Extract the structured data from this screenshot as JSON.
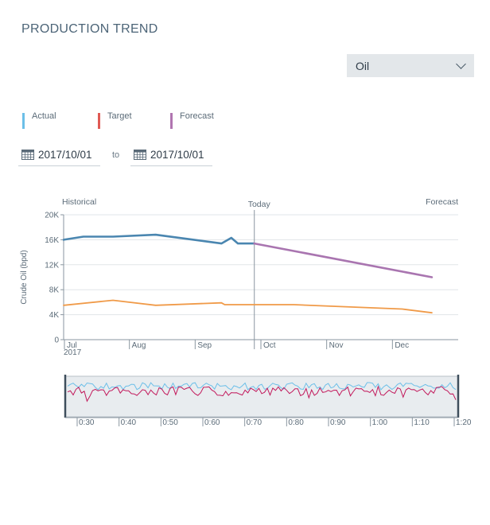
{
  "title": "PRODUCTION TREND",
  "product_select": {
    "value": "Oil"
  },
  "legend": [
    {
      "label": "Actual",
      "color": "#6cbfe8"
    },
    {
      "label": "Target",
      "color": "#e05a54"
    },
    {
      "label": "Forecast",
      "color": "#b075b0"
    }
  ],
  "date_range": {
    "from": "2017/10/01",
    "to_label": "to",
    "to": "2017/10/01"
  },
  "icons": {
    "date_picker": "calendar-icon",
    "select": "chevron-down-icon"
  },
  "chart_data": {
    "type": "line",
    "ylabel": "Crude Oil (bpd)",
    "yticks": [
      "0",
      "4K",
      "8K",
      "12K",
      "16K",
      "20K"
    ],
    "ylim": [
      0,
      20000
    ],
    "xlim": [
      0,
      6
    ],
    "xtick_labels": [
      {
        "x": 0,
        "label": "Jul"
      },
      {
        "x": 1,
        "label": "Aug"
      },
      {
        "x": 2,
        "label": "Sep"
      },
      {
        "x": 3,
        "label": "Oct"
      },
      {
        "x": 4,
        "label": "Nov"
      },
      {
        "x": 5,
        "label": "Dec"
      }
    ],
    "year_label": "2017",
    "grid": true,
    "today_x": 2.9,
    "region_labels": {
      "historical": "Historical",
      "today": "Today",
      "forecast": "Forecast"
    },
    "series": [
      {
        "name": "Actual",
        "color": "#4a86b0",
        "x": [
          0,
          0.3,
          0.75,
          1.4,
          1.9,
          2.4,
          2.55,
          2.65,
          2.9
        ],
        "y": [
          16000,
          16500,
          16500,
          16800,
          16100,
          15400,
          16300,
          15400,
          15400
        ]
      },
      {
        "name": "Target",
        "color": "#f09a48",
        "x": [
          0,
          0.75,
          1.4,
          2.4,
          2.45,
          3.5,
          5.15,
          5.6
        ],
        "y": [
          5500,
          6300,
          5500,
          5900,
          5600,
          5600,
          4900,
          4300
        ]
      },
      {
        "name": "Forecast",
        "color": "#a975b0",
        "x": [
          2.9,
          5.6
        ],
        "y": [
          15400,
          10000
        ]
      }
    ],
    "navigator": {
      "tick_labels": [
        "0:30",
        "0:40",
        "0:50",
        "0:60",
        "0:70",
        "0:80",
        "0:90",
        "1:00",
        "1:10",
        "1:20"
      ],
      "colors": {
        "light": "#6cbfe8",
        "dark": "#c2185b"
      }
    }
  }
}
